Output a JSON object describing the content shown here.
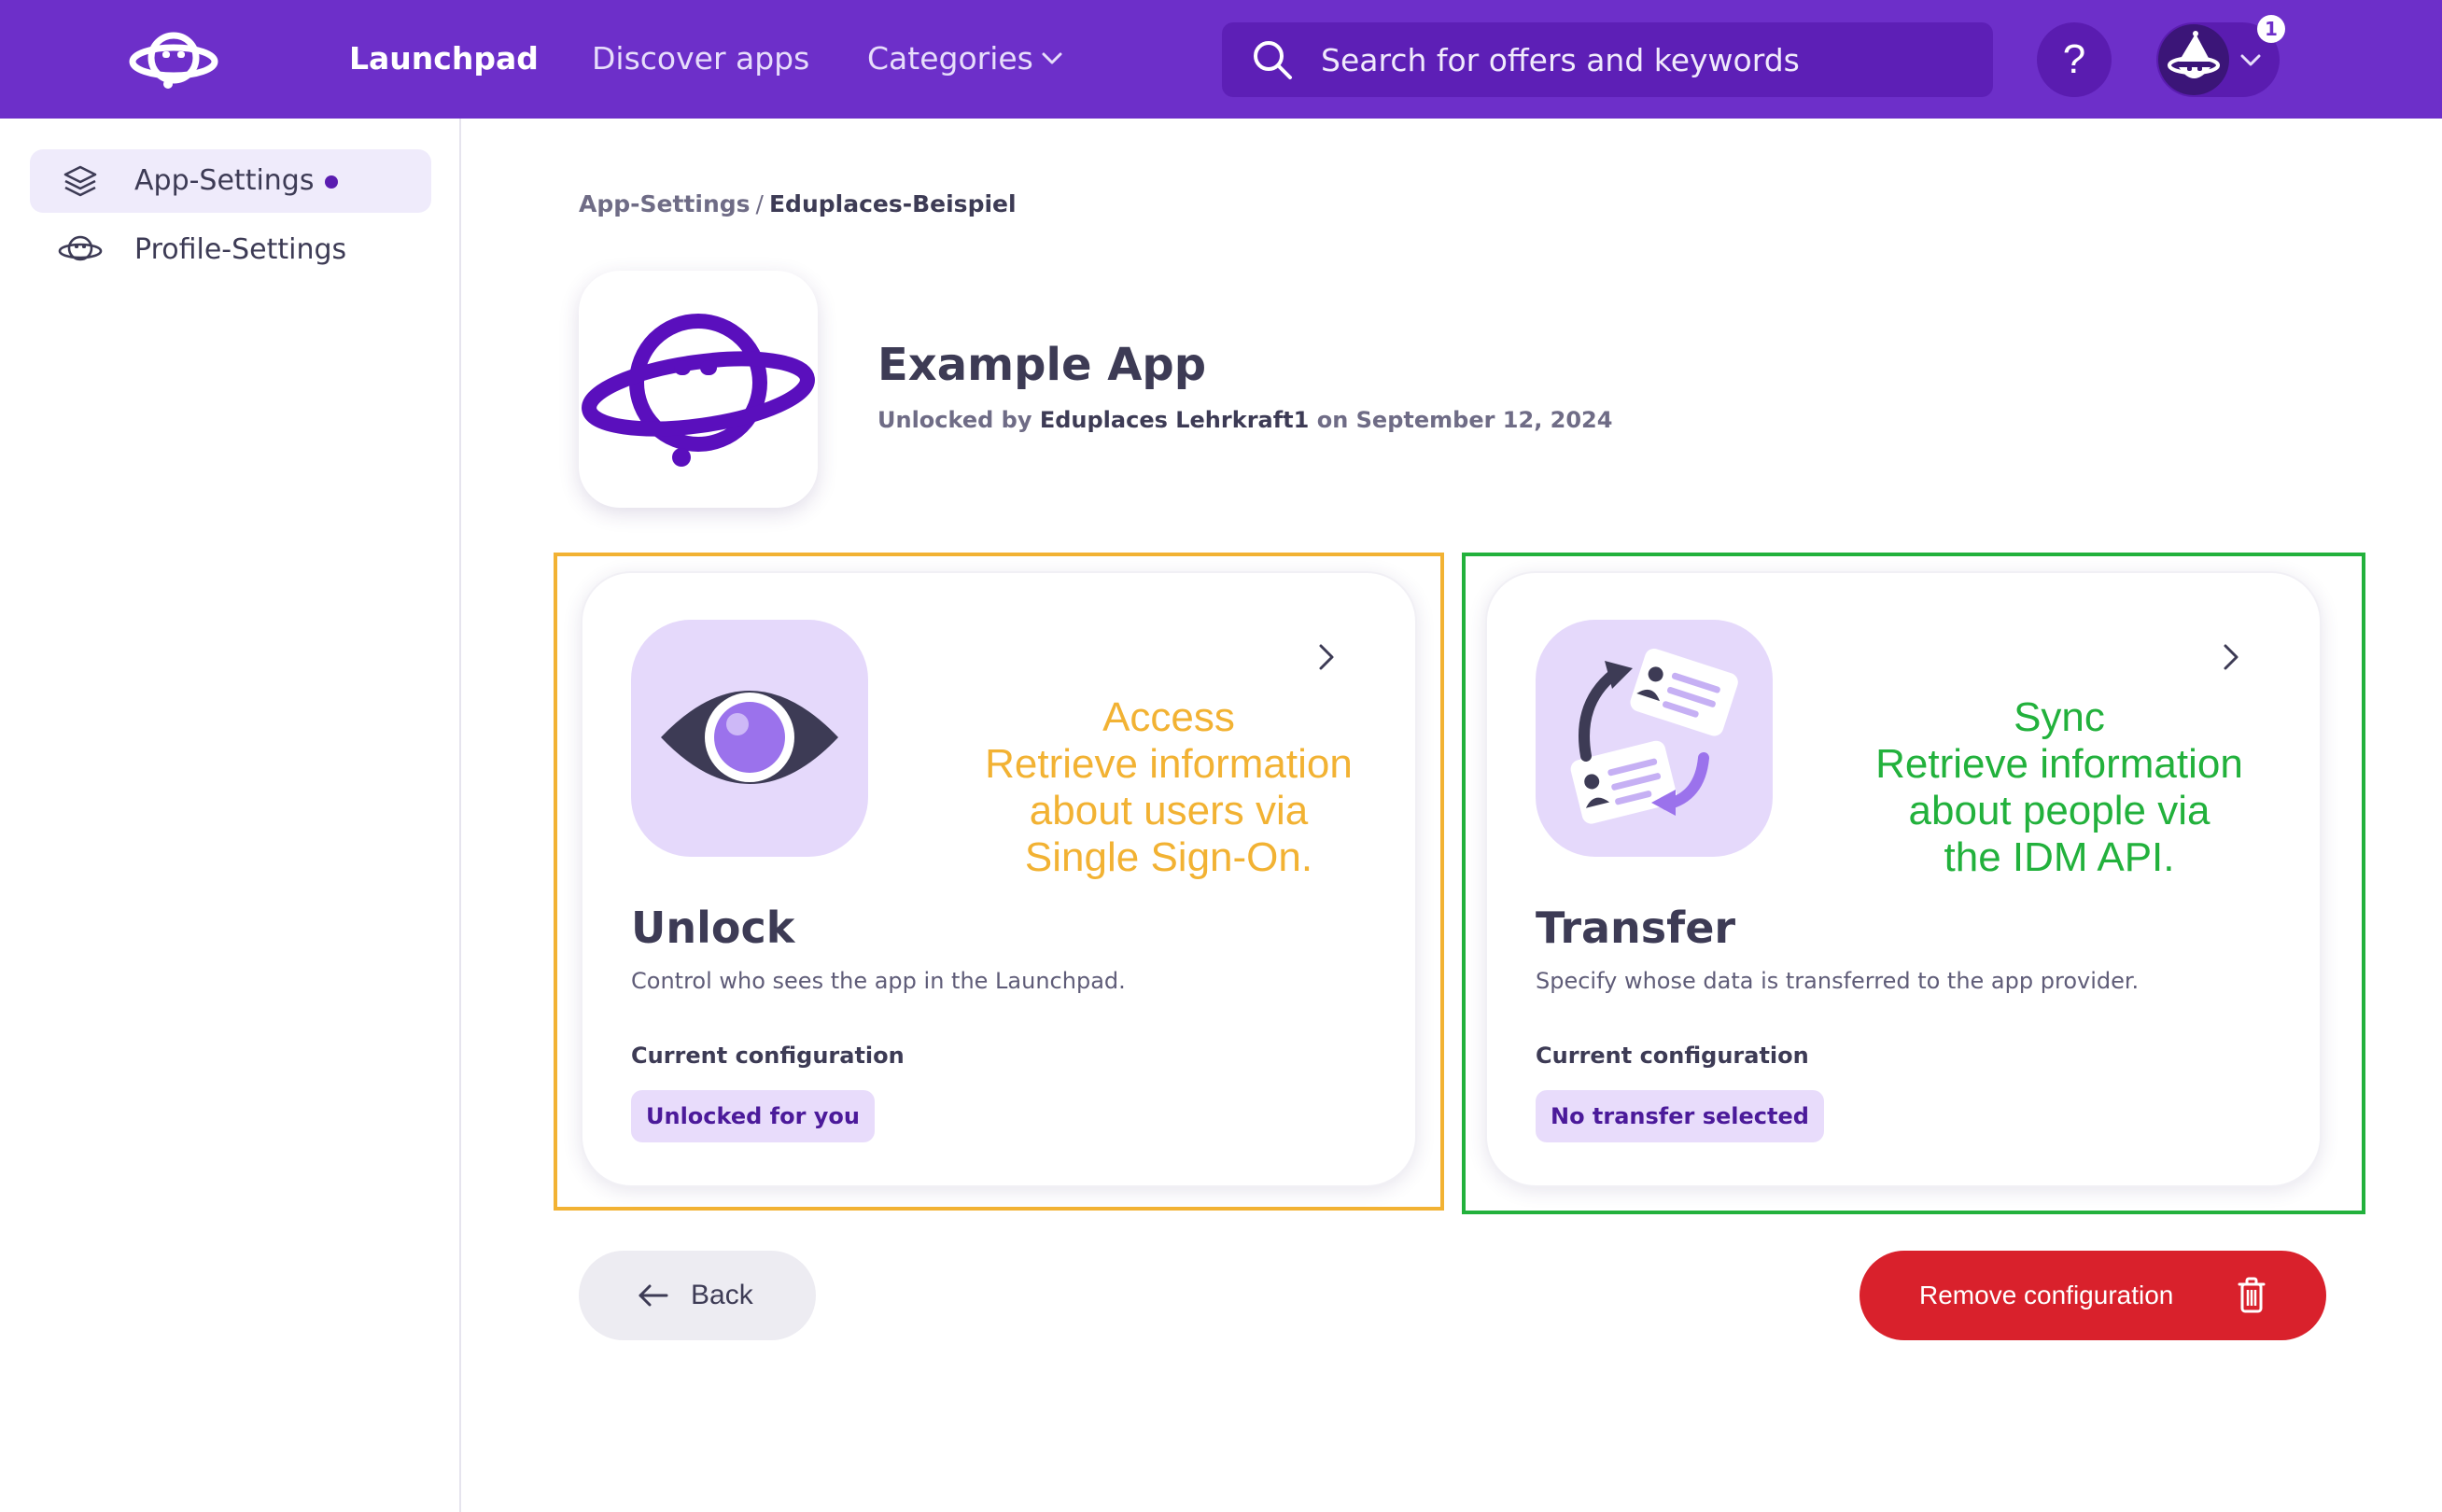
{
  "header": {
    "nav": {
      "launchpad": "Launchpad",
      "discover": "Discover apps",
      "categories": "Categories"
    },
    "search": {
      "placeholder": "Search for offers and keywords",
      "value": ""
    },
    "help_glyph": "?",
    "notifications_count": "1"
  },
  "sidebar": {
    "items": [
      {
        "label": "App-Settings",
        "active": true,
        "icon": "layers-icon"
      },
      {
        "label": "Profile-Settings",
        "active": false,
        "icon": "planet-icon"
      }
    ]
  },
  "breadcrumb": {
    "parent": "App-Settings",
    "separator": "/",
    "current": "Eduplaces-Beispiel"
  },
  "app": {
    "title": "Example App",
    "unlocked_prefix": "Unlocked by",
    "unlocked_by": "Eduplaces Lehrkraft1",
    "unlocked_on_prefix": "on",
    "unlocked_date": "September 12, 2024"
  },
  "cards": {
    "unlock": {
      "icon": "eye-icon",
      "title": "Unlock",
      "description": "Control who sees the app in the Launchpad.",
      "config_label": "Current configuration",
      "badge": "Unlocked for you"
    },
    "transfer": {
      "icon": "sync-cards-icon",
      "title": "Transfer",
      "description": "Specify whose data is transferred to the app provider.",
      "config_label": "Current configuration",
      "badge": "No transfer selected"
    }
  },
  "annotations": {
    "access": {
      "color": "#f2b233",
      "lines": [
        "Access",
        "Retrieve information",
        "about users via",
        "Single Sign-On."
      ]
    },
    "sync": {
      "color": "#22b13c",
      "lines": [
        "Sync",
        "Retrieve information",
        "about people via",
        "the IDM API."
      ]
    }
  },
  "actions": {
    "back": "Back",
    "remove": "Remove configuration"
  },
  "colors": {
    "brand": "#6d2fc9",
    "accent_light": "#e5d9fb",
    "danger": "#d9212c",
    "text": "#3d3b55"
  }
}
